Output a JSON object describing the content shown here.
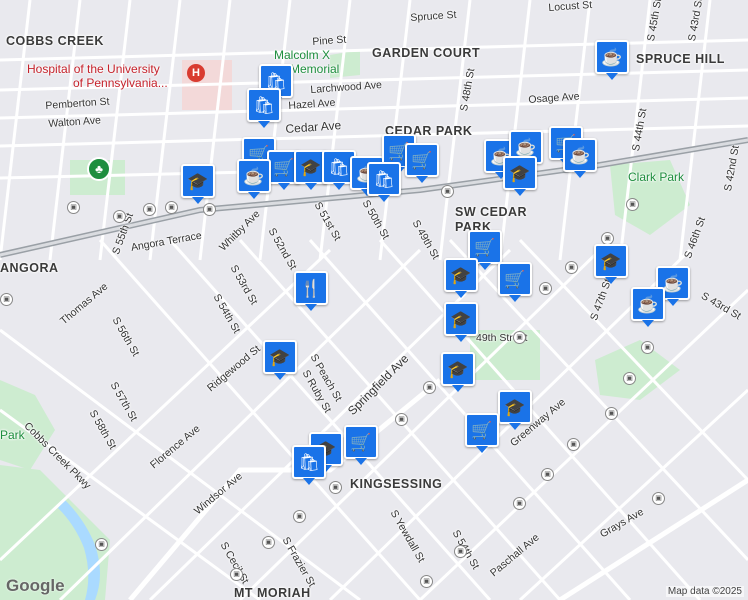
{
  "map": {
    "area_labels": [
      "COBBS CREEK",
      "GARDEN COURT",
      "CEDAR PARK",
      "SW CEDAR",
      "PARK",
      "ANGORA",
      "KINGSESSING",
      "MT MORIAH",
      "SPRUCE HILL"
    ],
    "hospital_label_line1": "Hospital of the University",
    "hospital_label_line2": "of Pennsylvania...",
    "landmark_line1": "Malcolm X",
    "landmark_line2": "Memorial",
    "park_labels": [
      "Clark Park",
      "Park"
    ],
    "street_labels": [
      "Spruce St",
      "Locust St",
      "S 45th St",
      "S 43rd St",
      "Pine St",
      "Larchwood Ave",
      "Osage Ave",
      "Cedar Ave",
      "Hazel Ave",
      "Pemberton St",
      "Walton Ave",
      "S 48th St",
      "S 44th St",
      "S 42nd St",
      "S 47th St",
      "S 46th St",
      "S 49th St",
      "S 50th St",
      "S 51st St",
      "S 52nd St",
      "S 53rd St",
      "S 54th St",
      "S 55th St",
      "S 56th St",
      "S 57th St",
      "S 58th St",
      "Whitby Ave",
      "Angora Terrace",
      "Thomas Ave",
      "Ridgewood St",
      "Florence Ave",
      "Cobbs Creek Pkwy",
      "Windsor Ave",
      "S Cecil St",
      "S Frazier St",
      "S Peach St",
      "S Ruby St",
      "Springfield Ave",
      "Greenway Ave",
      "S Yewdall St",
      "Paschall Ave",
      "Grays Ave",
      "S 43rd St",
      "S 54th St",
      "49th Street"
    ],
    "attribution": "Map data ©2025",
    "logo": "Google"
  },
  "pins": [
    {
      "icon": "shopping-bag-icon",
      "glyph": "🛍"
    },
    {
      "icon": "coffee-icon",
      "glyph": "☕"
    },
    {
      "icon": "shopping-cart-icon",
      "glyph": "🛒"
    },
    {
      "icon": "school-icon",
      "glyph": "🎓"
    },
    {
      "icon": "restaurant-icon",
      "glyph": "🍴"
    }
  ],
  "colors": {
    "pin": "#1a73e8",
    "park": "#cdecd0",
    "water": "#aadaff",
    "road": "#ffffff",
    "rail": "#9aa0a6",
    "hospital": "#c5222b"
  }
}
